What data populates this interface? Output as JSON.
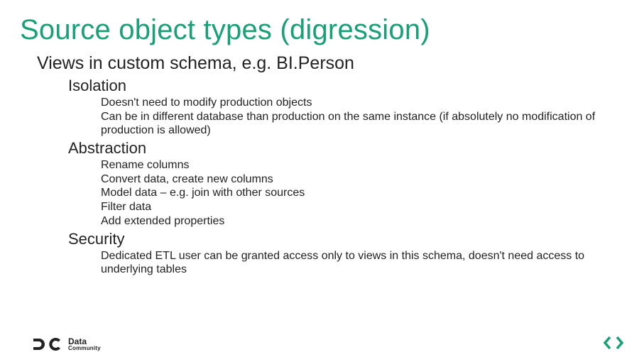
{
  "title": "Source object types (digression)",
  "h1_views": "Views in custom schema, e.g. BI.Person",
  "sections": {
    "isolation": {
      "heading": "Isolation",
      "p1": "Doesn't need to modify production objects",
      "p2": "Can be in different database than production on the same instance (if absolutely no modification of production is allowed)"
    },
    "abstraction": {
      "heading": "Abstraction",
      "p1": "Rename columns",
      "p2": "Convert data, create new columns",
      "p3": "Model data – e.g. join with other sources",
      "p4": "Filter data",
      "p5": "Add extended properties"
    },
    "security": {
      "heading": "Security",
      "p1": "Dedicated ETL user can be granted access only to views in this schema, doesn't need access to underlying tables"
    }
  },
  "footer": {
    "line1": "Data",
    "line2": "Community"
  }
}
